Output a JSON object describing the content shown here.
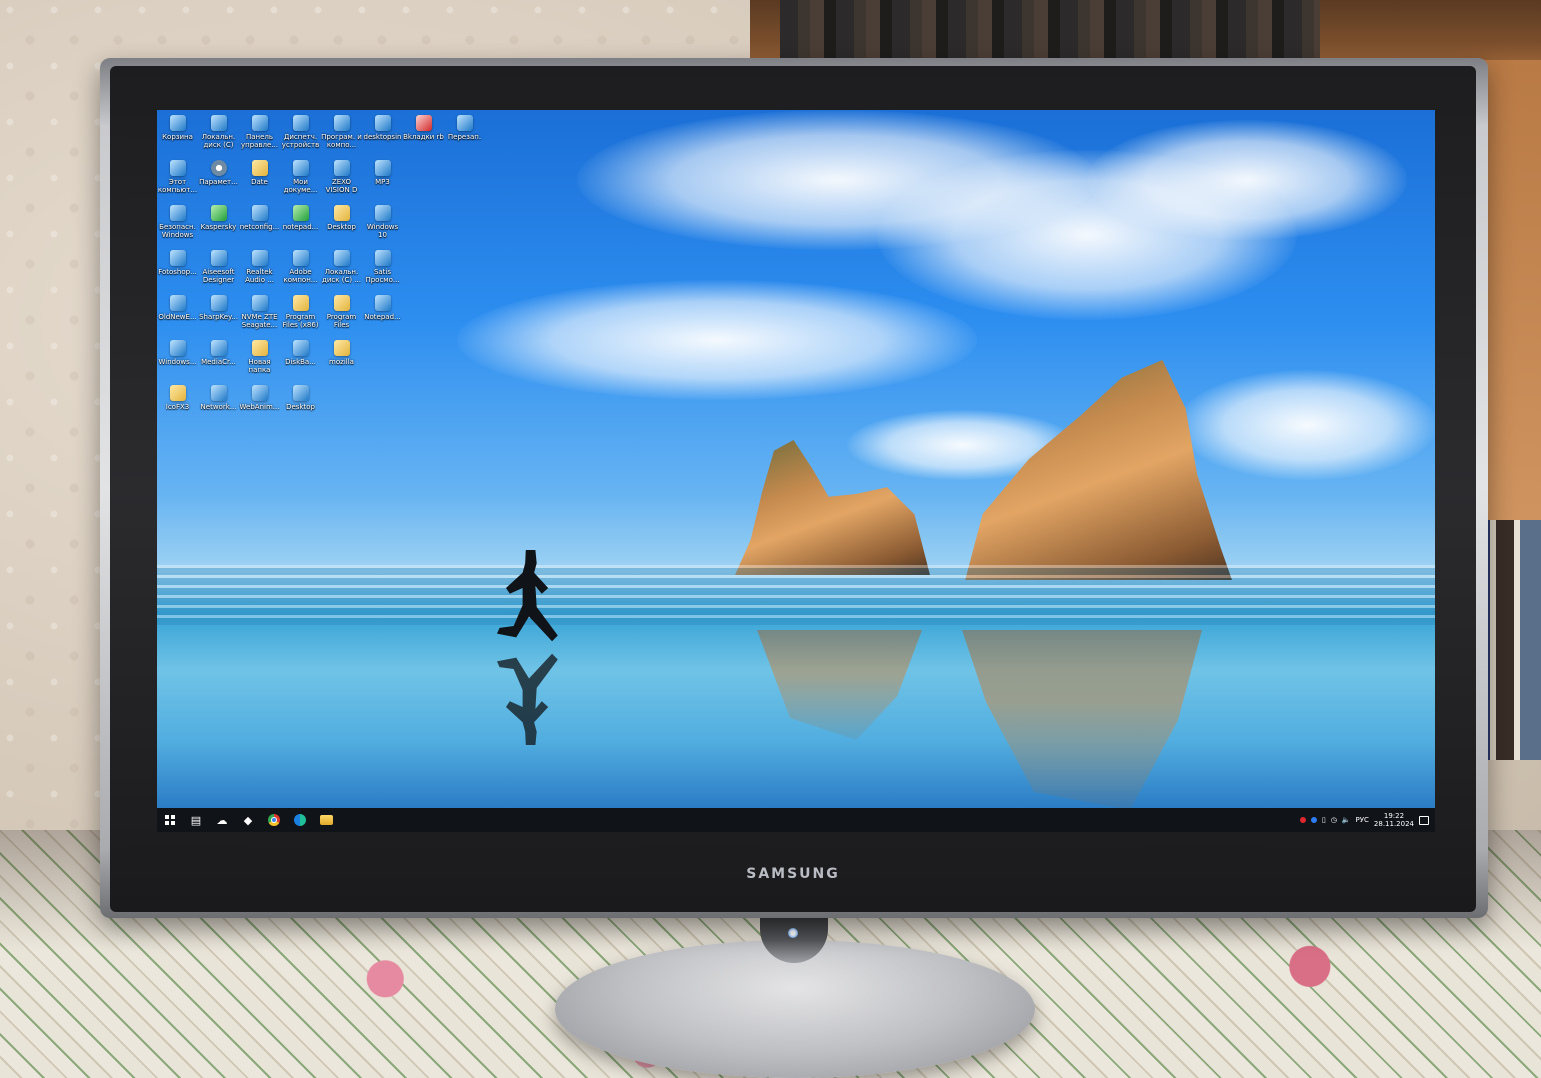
{
  "monitor": {
    "brand": "SAMSUNG"
  },
  "desktop": {
    "icons": [
      {
        "label": "Корзина",
        "icon": "recycle-bin-icon",
        "style": "g-blue"
      },
      {
        "label": "Локальн. диск (C)",
        "icon": "drive-icon",
        "style": "g-blue"
      },
      {
        "label": "Панель управле...",
        "icon": "control-panel-icon",
        "style": "g-blue"
      },
      {
        "label": "Диспетч. устройств",
        "icon": "device-manager-icon",
        "style": "g-blue"
      },
      {
        "label": "Програм. и компо...",
        "icon": "programs-icon",
        "style": "g-blue"
      },
      {
        "label": "desktopsin",
        "icon": "app-icon",
        "style": "g-blue"
      },
      {
        "label": "Вkладки rb",
        "icon": "pinterest-icon",
        "style": "g-red"
      },
      {
        "label": "Перезап.",
        "icon": "restart-icon",
        "style": "g-blue"
      },
      {
        "label": "Этот компьют...",
        "icon": "computer-icon",
        "style": "g-blue"
      },
      {
        "label": "Парамет...",
        "icon": "settings-icon",
        "style": "g-gear"
      },
      {
        "label": "Date",
        "icon": "folder-icon",
        "style": "g-folder"
      },
      {
        "label": "Мои докуме...",
        "icon": "documents-icon",
        "style": "g-blue"
      },
      {
        "label": "ZEXO VISION D",
        "icon": "app-icon",
        "style": "g-blue"
      },
      {
        "label": "MP3",
        "icon": "file-icon",
        "style": "g-blue"
      },
      {
        "label": "",
        "icon": "",
        "style": ""
      },
      {
        "label": "",
        "icon": "",
        "style": ""
      },
      {
        "label": "Безопасн. Windows",
        "icon": "security-icon",
        "style": "g-blue"
      },
      {
        "label": "Kaspersky",
        "icon": "kaspersky-icon",
        "style": "g-green"
      },
      {
        "label": "netconfig...",
        "icon": "network-icon",
        "style": "g-blue"
      },
      {
        "label": "notepad...",
        "icon": "notepad-icon",
        "style": "g-green"
      },
      {
        "label": "Desktop",
        "icon": "folder-icon",
        "style": "g-folder"
      },
      {
        "label": "Windows 10",
        "icon": "windows-icon",
        "style": "g-blue"
      },
      {
        "label": "",
        "icon": "",
        "style": ""
      },
      {
        "label": "",
        "icon": "",
        "style": ""
      },
      {
        "label": "Fotoshop...",
        "icon": "file-icon",
        "style": "g-blue"
      },
      {
        "label": "Aiseesoft Designer",
        "icon": "app-icon",
        "style": "g-blue"
      },
      {
        "label": "Realtek Audio ...",
        "icon": "audio-icon",
        "style": "g-blue"
      },
      {
        "label": "Adobe компон...",
        "icon": "adobe-icon",
        "style": "g-blue"
      },
      {
        "label": "Локальн. диск (C) ...",
        "icon": "drive-icon",
        "style": "g-blue"
      },
      {
        "label": "Satis Просмо...",
        "icon": "app-icon",
        "style": "g-blue"
      },
      {
        "label": "",
        "icon": "",
        "style": ""
      },
      {
        "label": "",
        "icon": "",
        "style": ""
      },
      {
        "label": "OldNewE...",
        "icon": "app-icon",
        "style": "g-blue"
      },
      {
        "label": "SharpKey...",
        "icon": "app-icon",
        "style": "g-blue"
      },
      {
        "label": "NVMe ZTE Seagate...",
        "icon": "drive-icon",
        "style": "g-blue"
      },
      {
        "label": "Program Files (x86)",
        "icon": "folder-icon",
        "style": "g-folder"
      },
      {
        "label": "Program Files",
        "icon": "folder-icon",
        "style": "g-folder"
      },
      {
        "label": "Notepad...",
        "icon": "notepad-icon",
        "style": "g-blue"
      },
      {
        "label": "",
        "icon": "",
        "style": ""
      },
      {
        "label": "",
        "icon": "",
        "style": ""
      },
      {
        "label": "Windows...",
        "icon": "file-icon",
        "style": "g-blue"
      },
      {
        "label": "MediaCr...",
        "icon": "media-icon",
        "style": "g-blue"
      },
      {
        "label": "Новая папка",
        "icon": "folder-icon",
        "style": "g-folder"
      },
      {
        "label": "DiskBa...",
        "icon": "app-icon",
        "style": "g-blue"
      },
      {
        "label": "mozilla",
        "icon": "folder-icon",
        "style": "g-folder"
      },
      {
        "label": "",
        "icon": "",
        "style": ""
      },
      {
        "label": "",
        "icon": "",
        "style": ""
      },
      {
        "label": "",
        "icon": "",
        "style": ""
      },
      {
        "label": "IcoFX3",
        "icon": "file-icon",
        "style": "g-folder"
      },
      {
        "label": "Network...",
        "icon": "network-icon",
        "style": "g-blue"
      },
      {
        "label": "WebAnim...",
        "icon": "file-icon",
        "style": "g-blue"
      },
      {
        "label": "Desktop",
        "icon": "folder-icon",
        "style": "g-blue"
      }
    ]
  },
  "taskbar": {
    "buttons": [
      {
        "name": "start-button",
        "icon": "windows-logo-icon"
      },
      {
        "name": "task-view-button",
        "icon": "task-view-icon"
      },
      {
        "name": "taskbar-app-1",
        "icon": "cloud-app-icon"
      },
      {
        "name": "taskbar-app-2",
        "icon": "app-icon"
      },
      {
        "name": "taskbar-chrome",
        "icon": "chrome-icon"
      },
      {
        "name": "taskbar-edge",
        "icon": "edge-icon"
      },
      {
        "name": "taskbar-explorer",
        "icon": "file-explorer-icon"
      }
    ],
    "tray": {
      "language": "РУС",
      "time": "19:22",
      "date": "28.11.2024"
    }
  }
}
